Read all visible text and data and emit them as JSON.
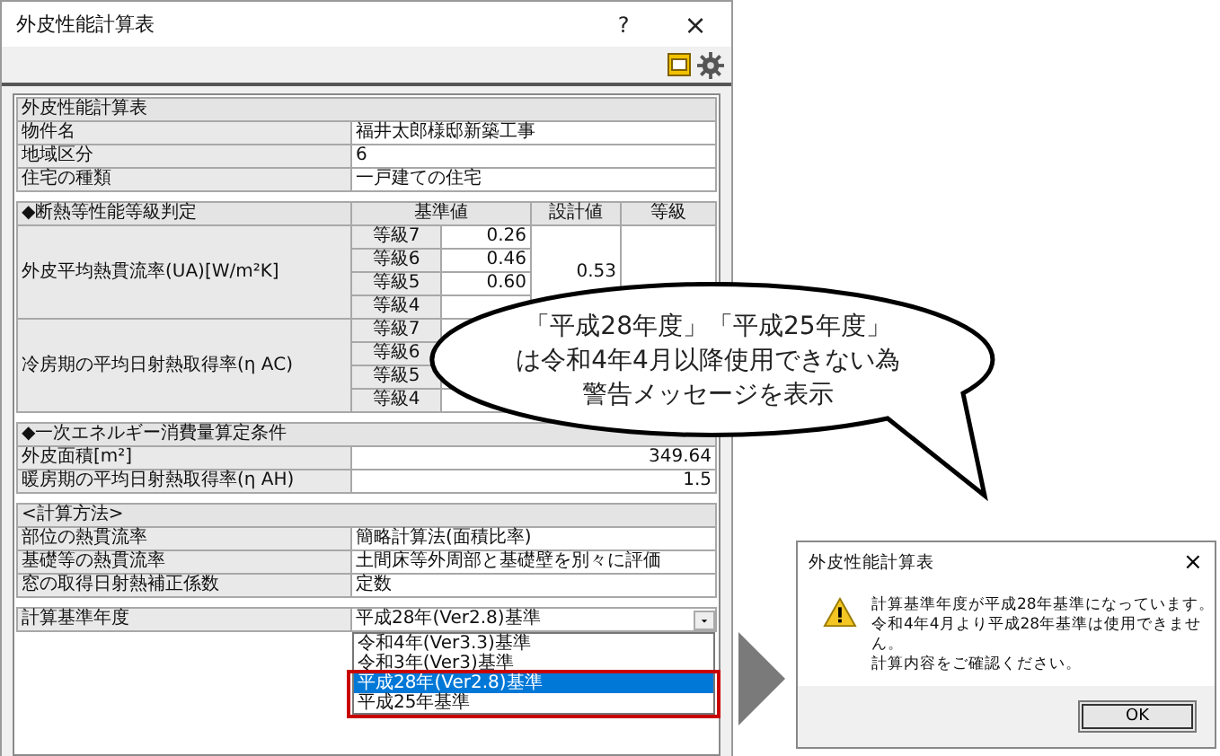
{
  "window": {
    "title": "外皮性能計算表",
    "help": "?",
    "close": "×"
  },
  "table_title": "外皮性能計算表",
  "info_rows": [
    {
      "label": "物件名",
      "value": "福井太郎様邸新築工事"
    },
    {
      "label": "地域区分",
      "value": "6"
    },
    {
      "label": "住宅の種類",
      "value": "一戸建ての住宅"
    }
  ],
  "insulation": {
    "heading": "◆断熱等性能等級判定",
    "columns": [
      "基準値",
      "設計値",
      "等級"
    ],
    "items": [
      {
        "label": "外皮平均熱貫流率(UA)[W/m²K]",
        "design": "0.53",
        "grades": [
          {
            "grade": "等級7",
            "value": "0.26"
          },
          {
            "grade": "等級6",
            "value": "0.46"
          },
          {
            "grade": "等級5",
            "value": "0.60"
          },
          {
            "grade": "等級4"
          }
        ]
      },
      {
        "label": "冷房期の平均日射熱取得率(η AC)",
        "grades": [
          {
            "grade": "等級7"
          },
          {
            "grade": "等級6"
          },
          {
            "grade": "等級5"
          },
          {
            "grade": "等級4"
          }
        ]
      }
    ]
  },
  "energy": {
    "heading": "◆一次エネルギー消費量算定条件",
    "rows": [
      {
        "label": "外皮面積[m²]",
        "value": "349.64"
      },
      {
        "label": "暖房期の平均日射熱取得率(η AH)",
        "value": "1.5"
      }
    ]
  },
  "method": {
    "heading": "<計算方法>",
    "rows": [
      {
        "label": "部位の熱貫流率",
        "value": "簡略計算法(面積比率)"
      },
      {
        "label": "基礎等の熱貫流率",
        "value": "土間床等外周部と基礎壁を別々に評価"
      },
      {
        "label": "窓の取得日射熱補正係数",
        "value": "定数"
      }
    ]
  },
  "standard": {
    "label": "計算基準年度",
    "value": "平成28年(Ver2.8)基準",
    "options": [
      {
        "label": "令和4年(Ver3.3)基準",
        "selected": false
      },
      {
        "label": "令和3年(Ver3)基準",
        "selected": false
      },
      {
        "label": "平成28年(Ver2.8)基準",
        "selected": true
      },
      {
        "label": "平成25年基準",
        "selected": false
      }
    ]
  },
  "callout": {
    "lines": [
      "「平成28年度」「平成25年度」",
      "は令和4年4月以降使用できない為",
      "警告メッセージを表示"
    ]
  },
  "dialog": {
    "title": "外皮性能計算表",
    "close": "×",
    "lines": [
      "計算基準年度が平成28年基準になっています。",
      "令和4年4月より平成28年基準は使用できません。",
      "計算内容をご確認ください。"
    ],
    "ok": "OK"
  }
}
